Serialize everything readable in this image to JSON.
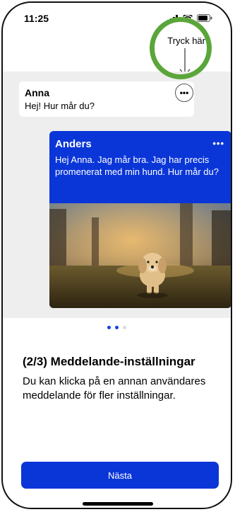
{
  "status_bar": {
    "time": "11:25"
  },
  "hint": {
    "label": "Tryck här"
  },
  "chat": {
    "message_1": {
      "sender": "Anna",
      "text": "Hej! Hur mår du?"
    },
    "message_2": {
      "sender": "Anders",
      "text": "Hej Anna. Jag mår bra. Jag har precis promenerat med min hund. Hur mår du?"
    }
  },
  "pager": {
    "current": 2,
    "total": 3
  },
  "info": {
    "title": "(2/3) Meddelande-inställningar",
    "text": "Du kan klicka på en annan användares meddelande för fler inställningar."
  },
  "next_button": {
    "label": "Nästa"
  },
  "colors": {
    "accent": "#0a36d8",
    "highlight_ring": "#5aa63a",
    "chat_bg": "#eeeeee"
  }
}
